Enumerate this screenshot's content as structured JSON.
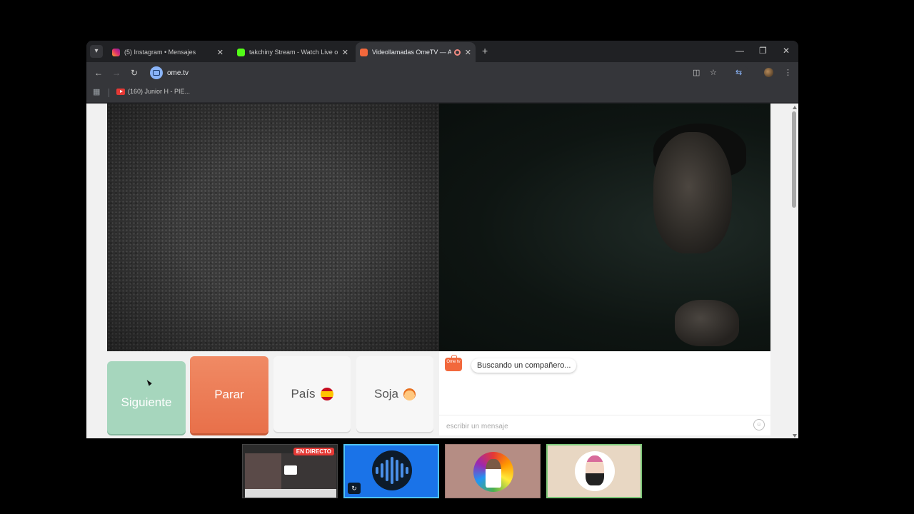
{
  "browser": {
    "tabs": [
      {
        "title": "(5) Instagram • Mensajes",
        "favicon_color": "#e1306c"
      },
      {
        "title": "takchiny Stream - Watch Live o",
        "favicon_color": "#53fc18"
      },
      {
        "title": "Videollamadas OmeTV — A",
        "favicon_color": "#f2683c",
        "active": true
      }
    ],
    "url": "ome.tv",
    "bookmark": "(160) Junior H - PIE..."
  },
  "ometv": {
    "buttons": {
      "next": "Siguiente",
      "stop": "Parar",
      "country": "País",
      "gender": "Soja"
    },
    "chat": {
      "logo_text": "Ome tv",
      "status_message": "Buscando un compañero...",
      "input_placeholder": "escribir un mensaje"
    }
  },
  "thumbnails": {
    "live_badge": "EN DIRECTO"
  },
  "colors": {
    "next_button": "#a6d6bd",
    "stop_button": "#f08a64",
    "accent": "#f2683c"
  }
}
